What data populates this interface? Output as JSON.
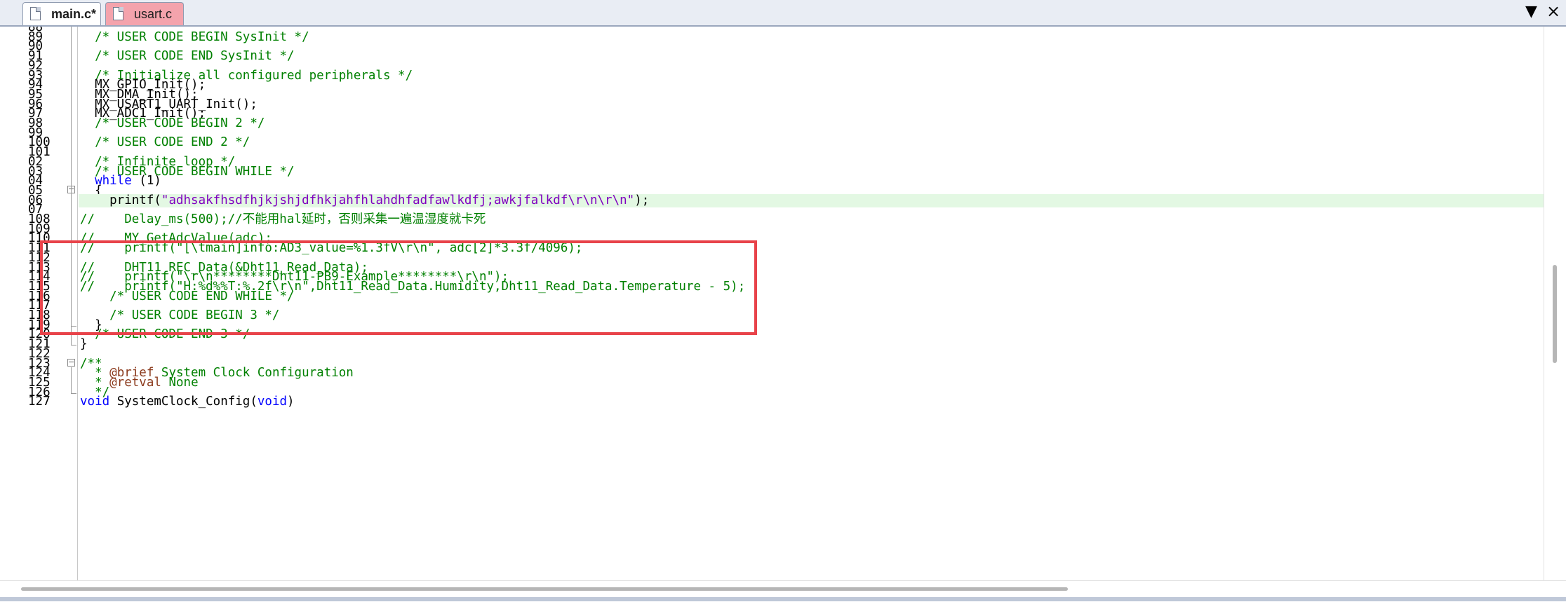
{
  "tabs": [
    {
      "label": "main.c*",
      "active": true
    },
    {
      "label": "usart.c",
      "active": false
    }
  ],
  "icons": {
    "tab_menu": "chevron-down-icon",
    "tab_close": "close-icon",
    "file": "file-icon"
  },
  "colors": {
    "comment": "#008000",
    "keyword": "#0000ff",
    "string": "#8000c0",
    "highlight_line": "#e3f8e3",
    "annotation_box": "#e8434a",
    "usart_tab": "#f4a3ac"
  },
  "editor": {
    "lines": [
      {
        "num": "88",
        "text": ""
      },
      {
        "num": "89",
        "text": "  /* USER CODE BEGIN SysInit */"
      },
      {
        "num": "90",
        "text": ""
      },
      {
        "num": "91",
        "text": "  /* USER CODE END SysInit */"
      },
      {
        "num": "92",
        "text": ""
      },
      {
        "num": "93",
        "text": "  /* Initialize all configured peripherals */"
      },
      {
        "num": "94",
        "text": "  MX_GPIO_Init();"
      },
      {
        "num": "95",
        "text": "  MX_DMA_Init();"
      },
      {
        "num": "96",
        "text": "  MX_USART1_UART_Init();"
      },
      {
        "num": "97",
        "text": "  MX_ADC1_Init();"
      },
      {
        "num": "98",
        "text": "  /* USER CODE BEGIN 2 */"
      },
      {
        "num": "99",
        "text": ""
      },
      {
        "num": "100",
        "text": "  /* USER CODE END 2 */"
      },
      {
        "num": "101",
        "text": ""
      },
      {
        "num": "02",
        "text": "  /* Infinite loop */"
      },
      {
        "num": "03",
        "text": "  /* USER CODE BEGIN WHILE */"
      },
      {
        "num": "04",
        "text": "  while (1)"
      },
      {
        "num": "05",
        "text": "  {"
      },
      {
        "num": "06",
        "text": "    printf(\"adhsakfhsdfhjkjshjdfhkjahfhlahdhfadfawlkdfj;awkjfalkdf\\r\\n\\r\\n\");"
      },
      {
        "num": "07",
        "text": ""
      },
      {
        "num": "108",
        "text": "//    Delay_ms(500);//不能用hal延时，否则采集一遍温湿度就卡死"
      },
      {
        "num": "109",
        "text": ""
      },
      {
        "num": "110",
        "text": "//    MY_GetAdcValue(adc);"
      },
      {
        "num": "111",
        "text": "//    printf(\"[\\tmain]info:AD3_value=%1.3fV\\r\\n\", adc[2]*3.3f/4096);"
      },
      {
        "num": "112",
        "text": ""
      },
      {
        "num": "113",
        "text": "//    DHT11_REC_Data(&Dht11_Read_Data);"
      },
      {
        "num": "114",
        "text": "//    printf(\"\\r\\n********Dht11-PB9-Example********\\r\\n\");"
      },
      {
        "num": "115",
        "text": "//    printf(\"H:%d%%T:%.2f\\r\\n\",Dht11_Read_Data.Humidity,Dht11_Read_Data.Temperature - 5);"
      },
      {
        "num": "116",
        "text": "    /* USER CODE END WHILE */"
      },
      {
        "num": "117",
        "text": ""
      },
      {
        "num": "118",
        "text": "    /* USER CODE BEGIN 3 */"
      },
      {
        "num": "119",
        "text": "  }"
      },
      {
        "num": "120",
        "text": "  /* USER CODE END 3 */"
      },
      {
        "num": "121",
        "text": "}"
      },
      {
        "num": "122",
        "text": ""
      },
      {
        "num": "123",
        "text": "/**"
      },
      {
        "num": "124",
        "text": "  * @brief System Clock Configuration"
      },
      {
        "num": "125",
        "text": "  * @retval None"
      },
      {
        "num": "126",
        "text": "  */"
      },
      {
        "num": "127",
        "text": "void SystemClock_Config(void)"
      }
    ]
  }
}
